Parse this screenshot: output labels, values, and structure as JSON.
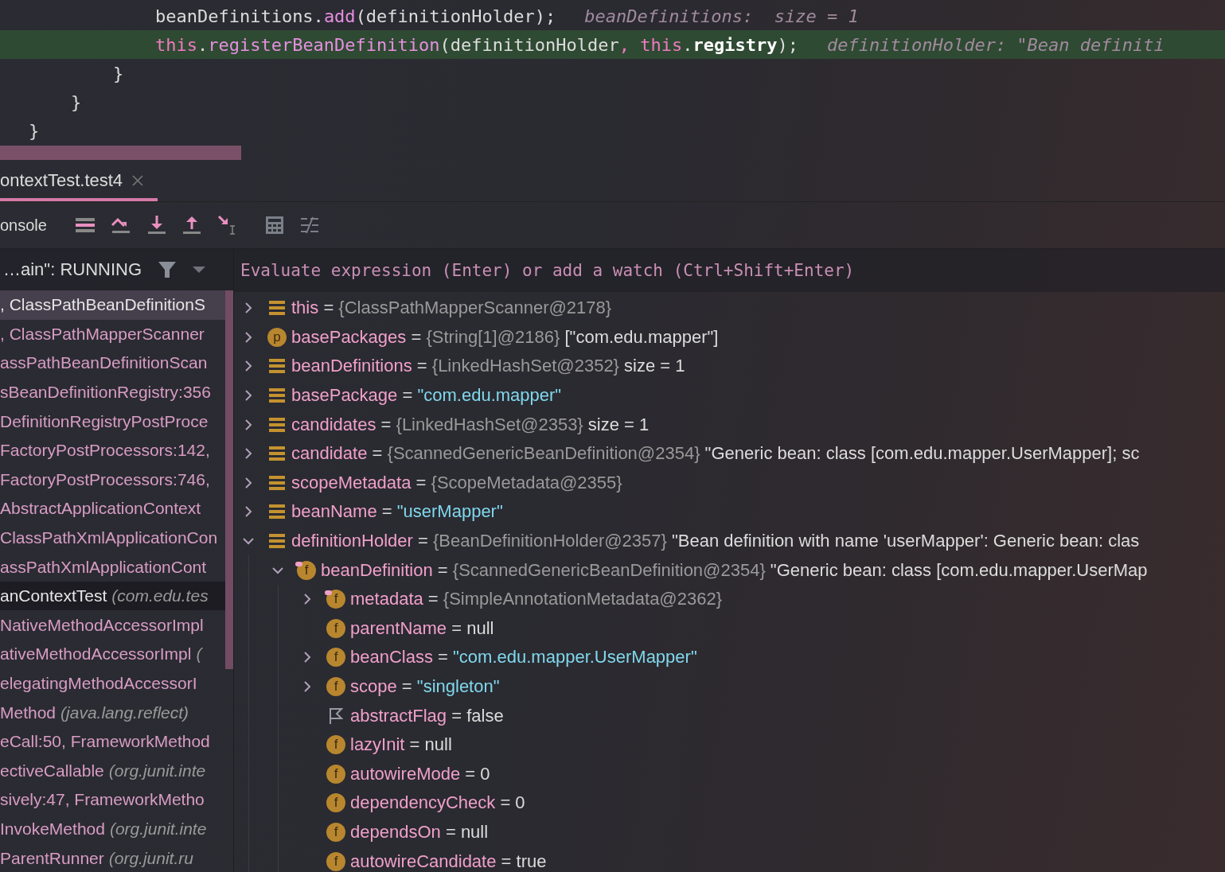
{
  "code": {
    "lines": [
      {
        "highlighted": false,
        "tokens": [
          {
            "kind": "plain",
            "text": "            beanDefinitions."
          },
          {
            "kind": "method",
            "text": "add"
          },
          {
            "kind": "plain",
            "text": "(definitionHolder);"
          }
        ],
        "hint": "beanDefinitions:  size = 1"
      },
      {
        "highlighted": true,
        "tokens": [
          {
            "kind": "keyword",
            "text": "            this"
          },
          {
            "kind": "plain",
            "text": "."
          },
          {
            "kind": "method",
            "text": "registerBeanDefinition"
          },
          {
            "kind": "plain",
            "text": "(definitionHolder"
          },
          {
            "kind": "keyword",
            "text": ", this"
          },
          {
            "kind": "plain",
            "text": "."
          },
          {
            "kind": "bold",
            "text": "registry"
          },
          {
            "kind": "plain",
            "text": ");"
          }
        ],
        "hint": "definitionHolder: \"Bean definiti"
      },
      {
        "highlighted": false,
        "tokens": [
          {
            "kind": "plain",
            "text": "        }"
          }
        ]
      },
      {
        "highlighted": false,
        "tokens": [
          {
            "kind": "plain",
            "text": "    }"
          }
        ]
      },
      {
        "highlighted": false,
        "tokens": [
          {
            "kind": "plain",
            "text": "}"
          }
        ]
      }
    ]
  },
  "tab": {
    "label": "ontextTest.test4",
    "selected": true
  },
  "toolbar": {
    "console_tab": "onsole"
  },
  "thread": {
    "label": "…ain\": RUNNING"
  },
  "evaluate": {
    "placeholder": "Evaluate expression (Enter) or add a watch (Ctrl+Shift+Enter)"
  },
  "frames": [
    {
      "text": ", ClassPathBeanDefinitionS",
      "kind": "library",
      "selected": true
    },
    {
      "text": ", ClassPathMapperScanner",
      "kind": "library",
      "selected": false
    },
    {
      "text": "assPathBeanDefinitionScan",
      "kind": "library",
      "selected": false
    },
    {
      "text": "sBeanDefinitionRegistry:356",
      "kind": "library",
      "selected": false
    },
    {
      "text": "DefinitionRegistryPostProce",
      "kind": "library",
      "selected": false
    },
    {
      "text": "FactoryPostProcessors:142,",
      "kind": "library",
      "selected": false
    },
    {
      "text": "FactoryPostProcessors:746,",
      "kind": "library",
      "selected": false
    },
    {
      "text": " AbstractApplicationContext",
      "kind": "library",
      "selected": false
    },
    {
      "text": "ClassPathXmlApplicationCon",
      "kind": "library",
      "selected": false
    },
    {
      "text": "assPathXmlApplicationCont",
      "kind": "library",
      "selected": false
    },
    {
      "text": "anContextTest",
      "package": "(com.edu.tes",
      "kind": "project",
      "selected": false
    },
    {
      "text": "NativeMethodAccessorImpl",
      "kind": "library",
      "selected": false
    },
    {
      "text": "ativeMethodAccessorImpl",
      "package": "(",
      "kind": "library",
      "selected": false
    },
    {
      "text": "elegatingMethodAccessorI",
      "kind": "library",
      "selected": false
    },
    {
      "text": "Method",
      "package": "(java.lang.reflect)",
      "kind": "library",
      "selected": false
    },
    {
      "text": "eCall:50, FrameworkMethod",
      "kind": "library",
      "selected": false
    },
    {
      "text": "ectiveCallable",
      "package": "(org.junit.inte",
      "kind": "library",
      "selected": false
    },
    {
      "text": "sively:47, FrameworkMetho",
      "kind": "library",
      "selected": false
    },
    {
      "text": " InvokeMethod",
      "package": "(org.junit.inte",
      "kind": "library",
      "selected": false
    },
    {
      "text": "ParentRunner",
      "package": "(org.junit.ru",
      "kind": "library",
      "selected": false
    }
  ],
  "variables": [
    {
      "kind": "object",
      "expanded": false,
      "name": "this",
      "equals": "=",
      "ref": "{ClassPathMapperScanner@2178}"
    },
    {
      "kind": "badge",
      "badge": "p",
      "expanded": false,
      "name": "basePackages",
      "equals": "=",
      "ref": "{String[1]@2186}",
      "value": "[\"com.edu.mapper\"]"
    },
    {
      "kind": "object",
      "expanded": false,
      "name": "beanDefinitions",
      "equals": "=",
      "ref": "{LinkedHashSet@2352}",
      "value": " size = 1"
    },
    {
      "kind": "object",
      "expanded": false,
      "name": "basePackage",
      "equals": "=",
      "string": "\"com.edu.mapper\""
    },
    {
      "kind": "object",
      "expanded": false,
      "name": "candidates",
      "equals": "=",
      "ref": "{LinkedHashSet@2353}",
      "value": " size = 1"
    },
    {
      "kind": "object",
      "expanded": false,
      "name": "candidate",
      "equals": "=",
      "ref": "{ScannedGenericBeanDefinition@2354}",
      "value": "\"Generic bean: class [com.edu.mapper.UserMapper]; sc"
    },
    {
      "kind": "object",
      "expanded": false,
      "name": "scopeMetadata",
      "equals": "=",
      "ref": "{ScopeMetadata@2355}"
    },
    {
      "kind": "object",
      "expanded": false,
      "name": "beanName",
      "equals": "=",
      "string": "\"userMapper\""
    },
    {
      "kind": "object",
      "expanded": true,
      "name": "definitionHolder",
      "equals": "=",
      "ref": "{BeanDefinitionHolder@2357}",
      "value": "\"Bean definition with name 'userMapper': Generic bean: clas",
      "children": [
        {
          "kind": "badge",
          "badge": "f",
          "marked": true,
          "expanded": true,
          "name": "beanDefinition",
          "equals": "=",
          "ref": "{ScannedGenericBeanDefinition@2354}",
          "value": "\"Generic bean: class [com.edu.mapper.UserMap",
          "children": [
            {
              "kind": "badge",
              "badge": "f",
              "marked": true,
              "expanded": false,
              "name": "metadata",
              "equals": "=",
              "ref": "{SimpleAnnotationMetadata@2362}"
            },
            {
              "kind": "badge",
              "badge": "f",
              "marked": false,
              "name": "parentName",
              "equals": "=",
              "value": "null"
            },
            {
              "kind": "badge",
              "badge": "f",
              "marked": false,
              "expanded": false,
              "name": "beanClass",
              "equals": "=",
              "string": "\"com.edu.mapper.UserMapper\""
            },
            {
              "kind": "badge",
              "badge": "f",
              "marked": false,
              "expanded": false,
              "name": "scope",
              "equals": "=",
              "string": "\"singleton\""
            },
            {
              "kind": "flag",
              "name": "abstractFlag",
              "equals": "=",
              "value": "false"
            },
            {
              "kind": "badge",
              "badge": "f",
              "marked": false,
              "name": "lazyInit",
              "equals": "=",
              "value": "null"
            },
            {
              "kind": "badge",
              "badge": "f",
              "marked": false,
              "name": "autowireMode",
              "equals": "=",
              "value": "0"
            },
            {
              "kind": "badge",
              "badge": "f",
              "marked": false,
              "name": "dependencyCheck",
              "equals": "=",
              "value": "0"
            },
            {
              "kind": "badge",
              "badge": "f",
              "marked": false,
              "name": "dependsOn",
              "equals": "=",
              "value": "null"
            },
            {
              "kind": "badge",
              "badge": "f",
              "marked": false,
              "name": "autowireCandidate",
              "equals": "=",
              "value": "true"
            }
          ]
        }
      ]
    }
  ]
}
